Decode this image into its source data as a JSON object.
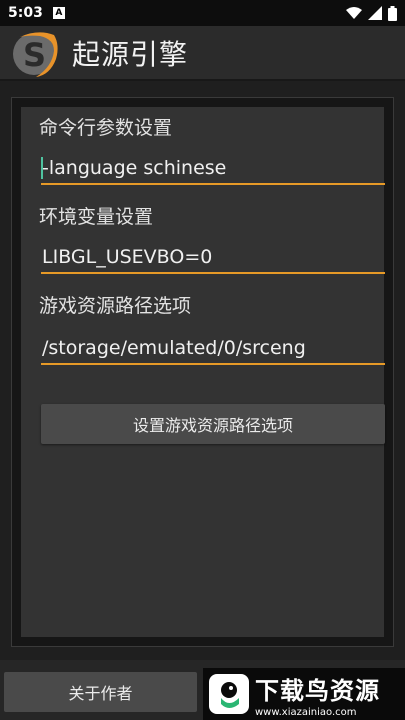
{
  "status_bar": {
    "time": "5:03",
    "notification_badge": "A",
    "icons": [
      "wifi-icon",
      "signal-icon",
      "battery-icon"
    ]
  },
  "app_bar": {
    "title": "起源引擎",
    "logo_icon": "source-engine-logo-icon"
  },
  "form": {
    "args_label": "命令行参数设置",
    "args_value": "-language schinese",
    "env_label": "环境变量设置",
    "env_value": "LIBGL_USEVBO=0",
    "path_label": "游戏资源路径选项",
    "path_value": "/storage/emulated/0/srceng",
    "set_path_button": "设置游戏资源路径选项"
  },
  "bottom": {
    "about_button": "关于作者"
  },
  "watermark": {
    "title": "下载鸟资源",
    "url": "www.xiazainiao.com"
  },
  "colors": {
    "accent": "#e79a27",
    "background": "#1f1f1f",
    "panel": "#333333",
    "button": "#4a4a4a"
  }
}
